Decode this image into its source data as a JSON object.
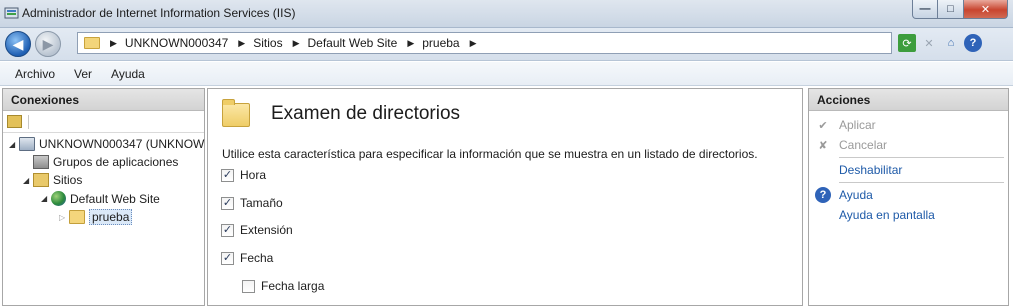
{
  "window": {
    "title": "Administrador de Internet Information Services (IIS)",
    "buttons": {
      "minimize": "—",
      "maximize": "□",
      "close": "✕"
    }
  },
  "address_bar": {
    "breadcrumbs": [
      "UNKNOWN000347",
      "Sitios",
      "Default Web Site",
      "prueba"
    ],
    "separator": "▶"
  },
  "toolbar_icons": [
    "refresh-icon",
    "stop-icon",
    "home-icon",
    "help-icon"
  ],
  "menu": [
    "Archivo",
    "Ver",
    "Ayuda"
  ],
  "connections": {
    "header": "Conexiones",
    "tree": [
      {
        "label": "UNKNOWN000347 (UNKNOW",
        "icon": "server-icon",
        "expanded": true
      },
      {
        "label": "Grupos de aplicaciones",
        "icon": "app-pool-icon"
      },
      {
        "label": "Sitios",
        "icon": "sites-icon",
        "expanded": true
      },
      {
        "label": "Default Web Site",
        "icon": "globe-icon",
        "expanded": true
      },
      {
        "label": "prueba",
        "icon": "folder-icon",
        "selected": true
      }
    ]
  },
  "feature": {
    "title": "Examen de directorios",
    "description": "Utilice esta característica para especificar la información que se muestra en un listado de directorios.",
    "options": [
      {
        "label": "Hora",
        "checked": true
      },
      {
        "label": "Tamaño",
        "checked": true
      },
      {
        "label": "Extensión",
        "checked": true
      },
      {
        "label": "Fecha",
        "checked": true
      },
      {
        "label": "Fecha larga",
        "checked": false
      }
    ]
  },
  "actions": {
    "header": "Acciones",
    "items": [
      {
        "label": "Aplicar",
        "enabled": false
      },
      {
        "label": "Cancelar",
        "enabled": false
      },
      {
        "label": "Deshabilitar",
        "enabled": true
      },
      {
        "label": "Ayuda",
        "enabled": true
      },
      {
        "label": "Ayuda en pantalla",
        "enabled": true
      }
    ]
  },
  "colors": {
    "link": "#1e5aa8",
    "disabled": "#9a9a9a",
    "selection": "#dbe9f8"
  }
}
